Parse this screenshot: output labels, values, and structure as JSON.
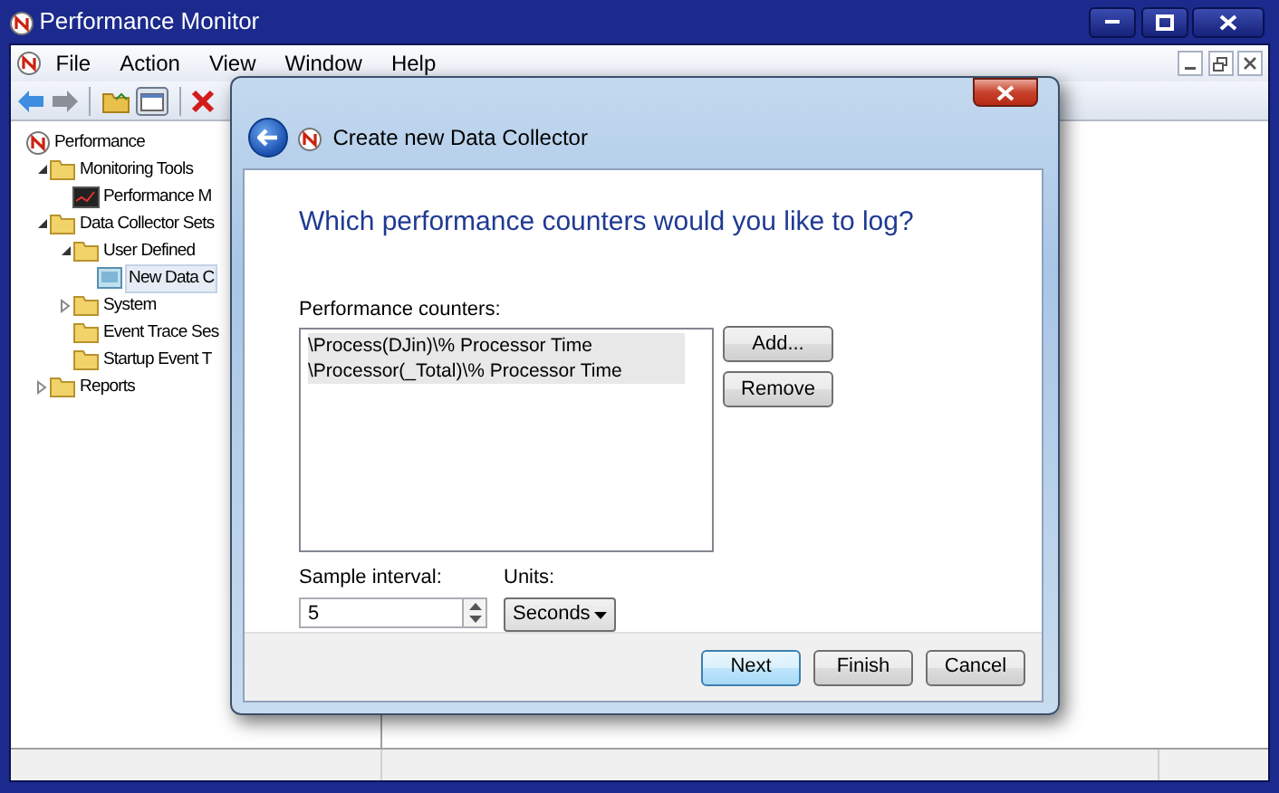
{
  "window": {
    "title": "Performance Monitor"
  },
  "menu": [
    {
      "label": "File"
    },
    {
      "label": "Action"
    },
    {
      "label": "View"
    },
    {
      "label": "Window"
    },
    {
      "label": "Help"
    }
  ],
  "tree": [
    {
      "label": "Performance",
      "kind": "app",
      "selected": false,
      "children": [
        {
          "label": "Monitoring Tools",
          "kind": "folder",
          "expanded": true,
          "selected": false,
          "children": [
            {
              "label": "Performance M",
              "kind": "chart",
              "selected": false
            }
          ]
        },
        {
          "label": "Data Collector Sets",
          "kind": "folder",
          "expanded": true,
          "selected": false,
          "children": [
            {
              "label": "User Defined",
              "kind": "folder",
              "expanded": true,
              "selected": false,
              "children": [
                {
                  "label": "New Data C",
                  "kind": "collector",
                  "selected": true
                }
              ]
            },
            {
              "label": "System",
              "kind": "folder",
              "expanded": false,
              "selected": false
            },
            {
              "label": "Event Trace Ses",
              "kind": "folder",
              "selected": false
            },
            {
              "label": "Startup Event T",
              "kind": "folder",
              "selected": false
            }
          ]
        },
        {
          "label": "Reports",
          "kind": "folder",
          "expanded": false,
          "selected": false
        }
      ]
    }
  ],
  "dialog": {
    "title": "Create new Data Collector",
    "heading": "Which performance counters would you like to log?",
    "counters_label": "Performance counters:",
    "counters": [
      {
        "label": "\\Process(DJin)\\% Processor Time",
        "selected": true
      },
      {
        "label": "\\Processor(_Total)\\% Processor Time",
        "selected": true
      }
    ],
    "side_buttons": [
      "Add...",
      "Remove"
    ],
    "interval": {
      "label": "Sample interval:",
      "value": "5"
    },
    "units": {
      "label": "Units:",
      "value": "Seconds"
    },
    "buttons": [
      {
        "label": "Next",
        "default": true
      },
      {
        "label": "Finish",
        "default": false
      },
      {
        "label": "Cancel",
        "default": false
      }
    ]
  }
}
